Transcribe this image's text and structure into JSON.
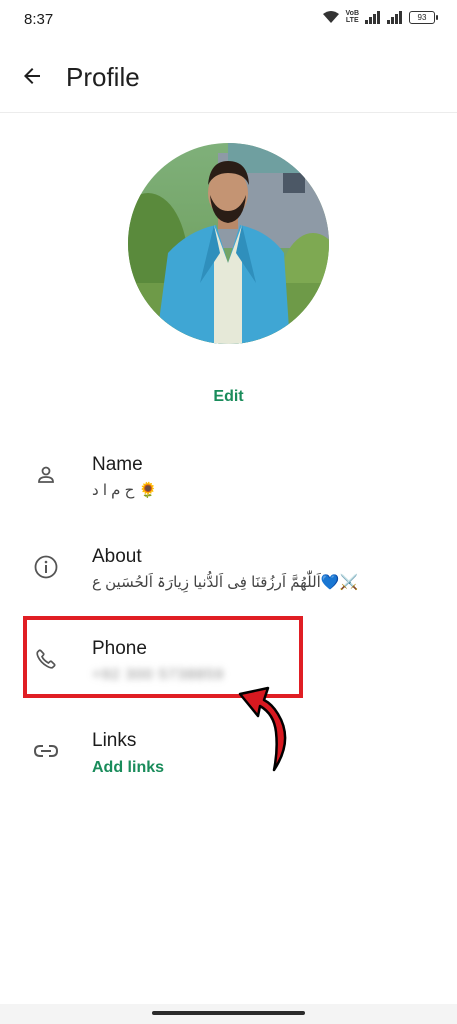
{
  "status_bar": {
    "time": "8:37",
    "volte_top": "VoB",
    "volte_bottom": "LTE",
    "battery": "93"
  },
  "header": {
    "title": "Profile"
  },
  "avatar": {
    "edit_label": "Edit"
  },
  "rows": {
    "name": {
      "label": "Name",
      "value": "ح م ا د 🌻"
    },
    "about": {
      "label": "About",
      "value": "اَللّٰھُمَّ اَرزُقنَا فِی اَلدُّنیا زِیارَۃ اَلحُسَین ع💙⚔️"
    },
    "phone": {
      "label": "Phone",
      "value": "+92 300 5738859"
    },
    "links": {
      "label": "Links",
      "action": "Add links"
    }
  },
  "colors": {
    "accent": "#1a8c5b",
    "annotation": "#e01e24"
  }
}
